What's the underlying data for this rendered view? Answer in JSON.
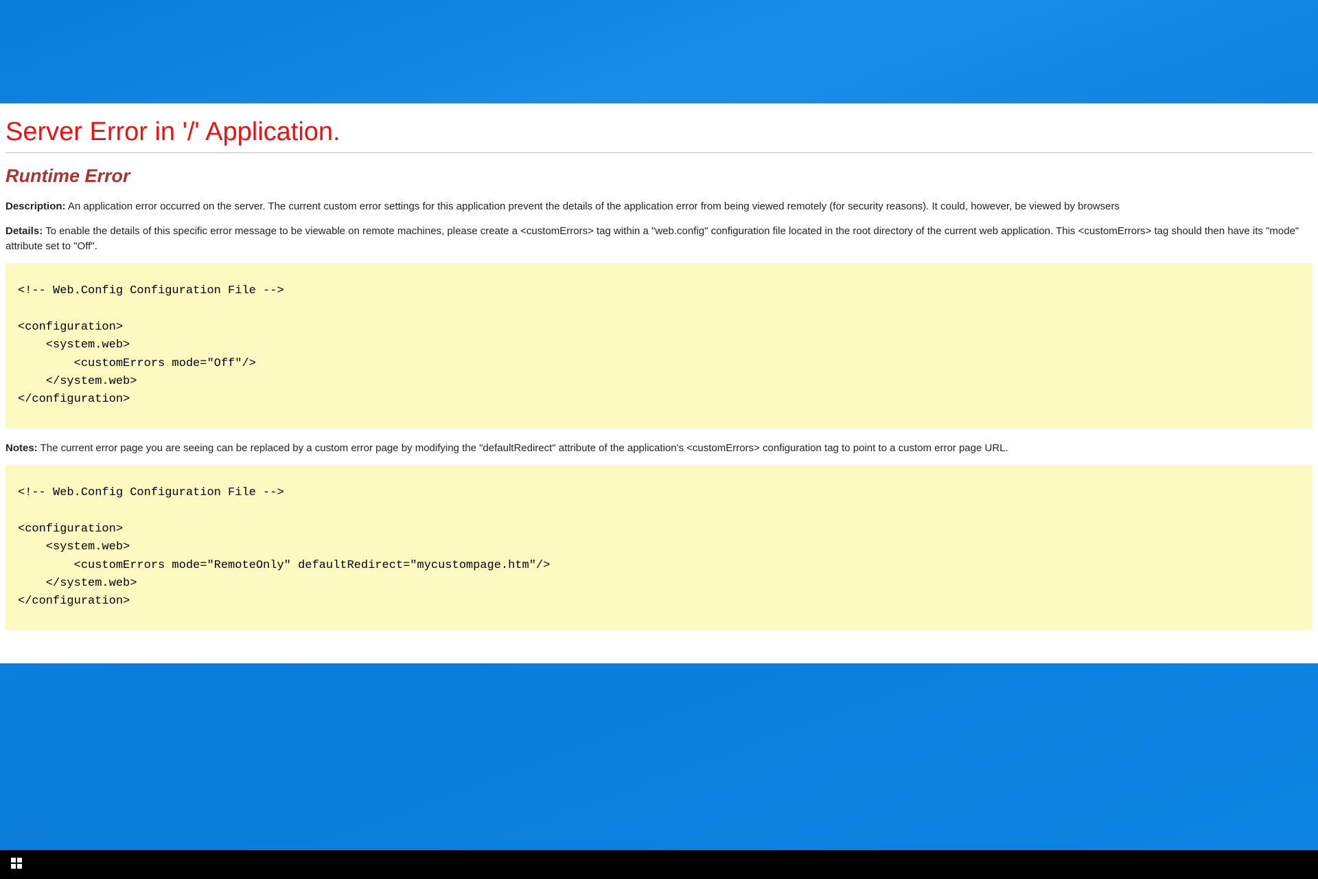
{
  "page": {
    "title": "Server Error in '/' Application.",
    "subtitle": "Runtime Error",
    "description_label": "Description:",
    "description_text": " An application error occurred on the server. The current custom error settings for this application prevent the details of the application error from being viewed remotely (for security reasons). It could, however, be viewed by browsers",
    "details_label": "Details:",
    "details_text": " To enable the details of this specific error message to be viewable on remote machines, please create a <customErrors> tag within a \"web.config\" configuration file located in the root directory of the current web application. This <customErrors> tag should then have its \"mode\" attribute set to \"Off\".",
    "code1": "<!-- Web.Config Configuration File -->\n\n<configuration>\n    <system.web>\n        <customErrors mode=\"Off\"/>\n    </system.web>\n</configuration>",
    "notes_label": "Notes:",
    "notes_text": " The current error page you are seeing can be replaced by a custom error page by modifying the \"defaultRedirect\" attribute of the application's <customErrors> configuration tag to point to a custom error page URL.",
    "code2": "<!-- Web.Config Configuration File -->\n\n<configuration>\n    <system.web>\n        <customErrors mode=\"RemoteOnly\" defaultRedirect=\"mycustompage.htm\"/>\n    </system.web>\n</configuration>"
  },
  "taskbar": {
    "start_name": "start-menu"
  }
}
